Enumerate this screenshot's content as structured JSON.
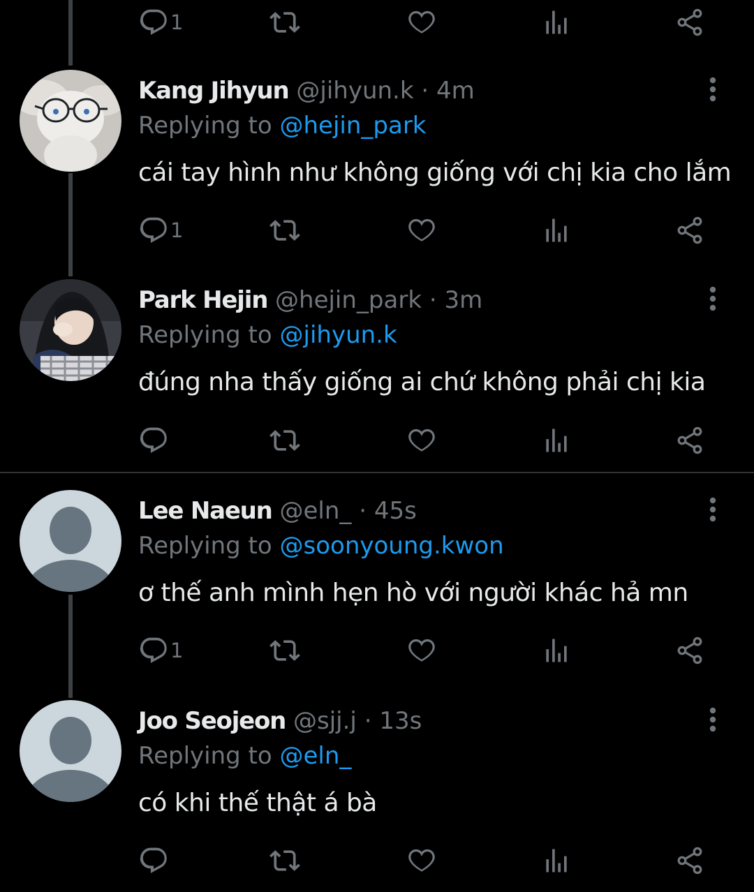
{
  "top_actions": {
    "reply_count": "1",
    "retweet_count": "",
    "like_count": ""
  },
  "tweets": [
    {
      "display_name": "Kang Jihyun",
      "handle": "@jihyun.k",
      "separator": "·",
      "time": "4m",
      "replying_prefix": "Replying to",
      "replying_to": "@hejin_park",
      "text": "cái tay hình như không giống với chị kia cho lắm",
      "reply_count": "1",
      "avatar": "plush-toy-with-glasses"
    },
    {
      "display_name": "Park Hejin",
      "handle": "@hejin_park",
      "separator": "·",
      "time": "3m",
      "replying_prefix": "Replying to",
      "replying_to": "@jihyun.k",
      "text": "đúng nha thấy giống ai chứ không phải chị kia",
      "reply_count": "",
      "avatar": "girl-selfie-photo"
    },
    {
      "display_name": "Lee Naeun",
      "handle": "@eln_",
      "separator": "·",
      "time": "45s",
      "replying_prefix": "Replying to",
      "replying_to": "@soonyoung.kwon",
      "text": "ơ thế anh mình hẹn hò với người khác hả mn",
      "reply_count": "1",
      "avatar": "default-profile"
    },
    {
      "display_name": "Joo Seojeon",
      "handle": "@sjj.j",
      "separator": "·",
      "time": "13s",
      "replying_prefix": "Replying to",
      "replying_to": "@eln_",
      "text": "có khi thế thật á bà",
      "reply_count": "",
      "avatar": "default-profile"
    }
  ],
  "colors": {
    "background": "#000000",
    "text": "#e7e9ea",
    "muted": "#71767b",
    "accent": "#1d9bf0",
    "thread_line": "#3e4144",
    "divider": "#2f3336"
  },
  "icons": {
    "reply": "reply-icon",
    "retweet": "retweet-icon",
    "like": "heart-icon",
    "views": "views-icon",
    "share": "share-icon",
    "more": "more-vertical-icon"
  }
}
